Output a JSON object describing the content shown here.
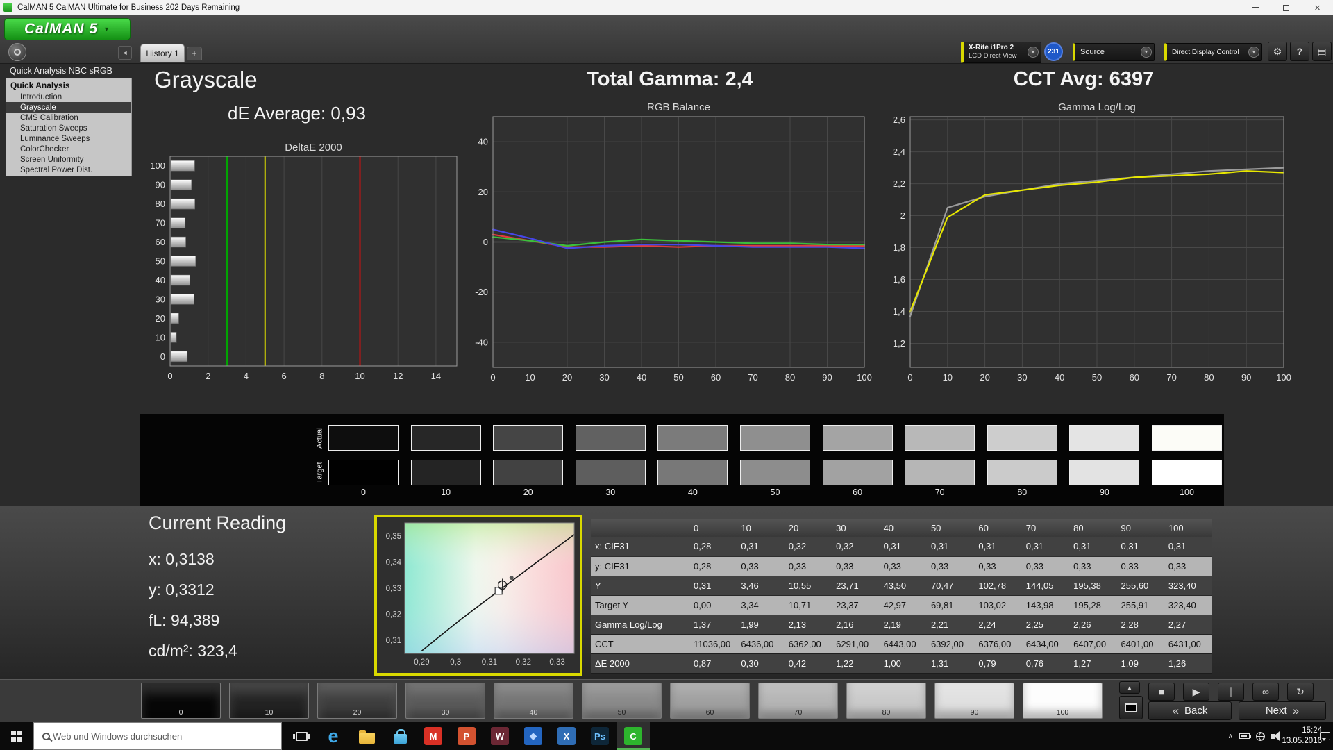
{
  "colors": {
    "accent_green": "#2fc12f",
    "selection_yellow": "#d9d900",
    "ref_green": "#00a800",
    "ref_yellow": "#d8d800",
    "ref_red": "#cc1111",
    "badge_blue": "#1f58c8"
  },
  "window": {
    "title": "CalMAN 5 CalMAN Ultimate for Business 202 Days Remaining",
    "logo_text": "CalMAN 5"
  },
  "header": {
    "tab_label": "History 1",
    "new_tab_glyph": "+",
    "meter_line1": "X-Rite i1Pro 2",
    "meter_line2": "LCD Direct View",
    "meter_badge": "231",
    "source_label": "Source",
    "display_control_label": "Direct Display Control",
    "help_glyph": "?"
  },
  "sidebar": {
    "title": "Quick Analysis NBC sRGB",
    "root_label": "Quick Analysis",
    "items": [
      "Introduction",
      "Grayscale",
      "CMS Calibration",
      "Saturation Sweeps",
      "Luminance Sweeps",
      "ColorChecker",
      "Screen Uniformity",
      "Spectral Power Dist."
    ],
    "selected_index": 1
  },
  "headline": {
    "page_title": "Grayscale",
    "de_average": "dE Average: 0,93",
    "total_gamma": "Total Gamma: 2,4",
    "cct_avg": "CCT Avg: 6397"
  },
  "chart_data": [
    {
      "id": "deltae",
      "type": "bar",
      "orientation": "horizontal",
      "title": "DeltaE 2000",
      "categories": [
        "100",
        "90",
        "80",
        "70",
        "60",
        "50",
        "40",
        "30",
        "20",
        "10",
        "0"
      ],
      "values": [
        1.26,
        1.09,
        1.27,
        0.76,
        0.79,
        1.31,
        1.0,
        1.22,
        0.42,
        0.3,
        0.87
      ],
      "xlim": [
        0,
        15.1
      ],
      "xticks": [
        [
          0,
          "0"
        ],
        [
          2,
          "2"
        ],
        [
          4,
          "4"
        ],
        [
          6,
          "6"
        ],
        [
          8,
          "8"
        ],
        [
          10,
          "10"
        ],
        [
          12,
          "12"
        ],
        [
          14,
          "14"
        ]
      ],
      "reference_lines": [
        [
          3,
          "#00a800"
        ],
        [
          5,
          "#d8d800"
        ],
        [
          10,
          "#cc1111"
        ]
      ]
    },
    {
      "id": "rgb_balance",
      "type": "line",
      "title": "RGB Balance",
      "x": [
        0,
        10,
        20,
        30,
        40,
        50,
        60,
        70,
        80,
        90,
        100
      ],
      "xlim": [
        0,
        100
      ],
      "xticks": [
        [
          0,
          "0"
        ],
        [
          10,
          "10"
        ],
        [
          20,
          "20"
        ],
        [
          30,
          "30"
        ],
        [
          40,
          "40"
        ],
        [
          50,
          "50"
        ],
        [
          60,
          "60"
        ],
        [
          70,
          "70"
        ],
        [
          80,
          "80"
        ],
        [
          90,
          "90"
        ],
        [
          100,
          "100"
        ]
      ],
      "ylim": [
        -50,
        50
      ],
      "yticks": [
        [
          40,
          "40"
        ],
        [
          20,
          "20"
        ],
        [
          0,
          "0"
        ],
        [
          -20,
          "-20"
        ],
        [
          -40,
          "-40"
        ]
      ],
      "grid": true,
      "legend": "none",
      "series": [
        {
          "name": "red",
          "color": "#e23b3b",
          "values": [
            3,
            0.5,
            -2,
            -2,
            -1.5,
            -2,
            -1.5,
            -1.5,
            -1.5,
            -1.5,
            -1.5
          ]
        },
        {
          "name": "green",
          "color": "#3bbf3b",
          "values": [
            2,
            0.5,
            -1.5,
            0,
            1,
            0.5,
            0,
            -0.5,
            -0.5,
            -1,
            -1
          ]
        },
        {
          "name": "blue",
          "color": "#4646e8",
          "values": [
            5,
            1.5,
            -2.5,
            -1.5,
            -1,
            -1,
            -1.5,
            -2,
            -2,
            -2,
            -2.5
          ]
        }
      ]
    },
    {
      "id": "gamma",
      "type": "line",
      "title": "Gamma Log/Log",
      "x": [
        0,
        10,
        20,
        30,
        40,
        50,
        60,
        70,
        80,
        90,
        100
      ],
      "xlim": [
        0,
        100
      ],
      "xticks": [
        [
          0,
          "0"
        ],
        [
          10,
          "10"
        ],
        [
          20,
          "20"
        ],
        [
          30,
          "30"
        ],
        [
          40,
          "40"
        ],
        [
          50,
          "50"
        ],
        [
          60,
          "60"
        ],
        [
          70,
          "70"
        ],
        [
          80,
          "80"
        ],
        [
          90,
          "90"
        ],
        [
          100,
          "100"
        ]
      ],
      "ylim": [
        1.05,
        2.62
      ],
      "yticks": [
        [
          2.6,
          "2,6"
        ],
        [
          2.4,
          "2,4"
        ],
        [
          2.2,
          "2,2"
        ],
        [
          2,
          "2"
        ],
        [
          1.8,
          "1,8"
        ],
        [
          1.6,
          "1,6"
        ],
        [
          1.4,
          "1,4"
        ],
        [
          1.2,
          "1,2"
        ]
      ],
      "grid": true,
      "legend": "none",
      "series": [
        {
          "name": "target",
          "color": "#9c9c9c",
          "values": [
            1.37,
            2.05,
            2.12,
            2.16,
            2.2,
            2.22,
            2.24,
            2.26,
            2.28,
            2.29,
            2.3
          ]
        },
        {
          "name": "measured",
          "color": "#e8e800",
          "values": [
            1.4,
            1.99,
            2.13,
            2.16,
            2.19,
            2.21,
            2.24,
            2.25,
            2.26,
            2.28,
            2.27
          ]
        }
      ]
    },
    {
      "id": "cie",
      "type": "scatter",
      "title": "",
      "xlim": [
        0.285,
        0.335
      ],
      "ylim": [
        0.305,
        0.355
      ],
      "xticks": [
        [
          0.29,
          "0,29"
        ],
        [
          0.3,
          "0,3"
        ],
        [
          0.31,
          "0,31"
        ],
        [
          0.32,
          "0,32"
        ],
        [
          0.33,
          "0,33"
        ]
      ],
      "yticks": [
        [
          0.35,
          "0,35"
        ],
        [
          0.34,
          "0,34"
        ],
        [
          0.33,
          "0,33"
        ],
        [
          0.32,
          "0,32"
        ],
        [
          0.31,
          "0,31"
        ]
      ],
      "locus": [
        [
          0.29,
          0.306
        ],
        [
          0.301,
          0.3175
        ],
        [
          0.3127,
          0.329
        ],
        [
          0.323,
          0.339
        ],
        [
          0.335,
          0.3505
        ]
      ],
      "target_point": [
        0.3127,
        0.329
      ],
      "actual_point": [
        0.3138,
        0.3312
      ],
      "extra_point": [
        0.3165,
        0.334
      ]
    }
  ],
  "swatches": {
    "top_label": "Actual",
    "bottom_label": "Target",
    "levels": [
      "0",
      "10",
      "20",
      "30",
      "40",
      "50",
      "60",
      "70",
      "80",
      "90",
      "100"
    ],
    "actual_colors": [
      "#0e0e0e",
      "#272727",
      "#454545",
      "#616161",
      "#7b7b7b",
      "#8f8f8f",
      "#a4a4a4",
      "#b8b8b8",
      "#cdcdcd",
      "#e4e4e4",
      "#fcfcf7"
    ],
    "target_colors": [
      "#010101",
      "#242424",
      "#424242",
      "#5e5e5e",
      "#787878",
      "#8d8d8d",
      "#a2a2a2",
      "#b6b6b6",
      "#cbcbcb",
      "#e3e3e3",
      "#ffffff"
    ]
  },
  "current_reading": {
    "title": "Current Reading",
    "x_value": "x: 0,3138",
    "y_value": "y: 0,3312",
    "fl_value": "fL: 94,389",
    "cd_value": "cd/m²: 323,4"
  },
  "results_table": {
    "header": [
      "",
      "0",
      "10",
      "20",
      "30",
      "40",
      "50",
      "60",
      "70",
      "80",
      "90",
      "100"
    ],
    "rows": [
      {
        "label": "x: CIE31",
        "values": [
          "0,28",
          "0,31",
          "0,32",
          "0,32",
          "0,31",
          "0,31",
          "0,31",
          "0,31",
          "0,31",
          "0,31",
          "0,31"
        ]
      },
      {
        "label": "y: CIE31",
        "values": [
          "0,28",
          "0,33",
          "0,33",
          "0,33",
          "0,33",
          "0,33",
          "0,33",
          "0,33",
          "0,33",
          "0,33",
          "0,33"
        ]
      },
      {
        "label": "Y",
        "values": [
          "0,31",
          "3,46",
          "10,55",
          "23,71",
          "43,50",
          "70,47",
          "102,78",
          "144,05",
          "195,38",
          "255,60",
          "323,40"
        ]
      },
      {
        "label": "Target Y",
        "values": [
          "0,00",
          "3,34",
          "10,71",
          "23,37",
          "42,97",
          "69,81",
          "103,02",
          "143,98",
          "195,28",
          "255,91",
          "323,40"
        ]
      },
      {
        "label": "Gamma Log/Log",
        "values": [
          "1,37",
          "1,99",
          "2,13",
          "2,16",
          "2,19",
          "2,21",
          "2,24",
          "2,25",
          "2,26",
          "2,28",
          "2,27"
        ]
      },
      {
        "label": "CCT",
        "values": [
          "11036,00",
          "6436,00",
          "6362,00",
          "6291,00",
          "6443,00",
          "6392,00",
          "6376,00",
          "6434,00",
          "6407,00",
          "6401,00",
          "6431,00"
        ]
      },
      {
        "label": "ΔE 2000",
        "values": [
          "0,87",
          "0,30",
          "0,42",
          "1,22",
          "1,00",
          "1,31",
          "0,79",
          "0,76",
          "1,27",
          "1,09",
          "1,26"
        ]
      }
    ]
  },
  "level_bar": {
    "levels": [
      "0",
      "10",
      "20",
      "30",
      "40",
      "50",
      "60",
      "70",
      "80",
      "90",
      "100"
    ],
    "colors": [
      "#070707",
      "#232323",
      "#3e3e3e",
      "#5a5a5a",
      "#757575",
      "#8a8a8a",
      "#a0a0a0",
      "#b5b5b5",
      "#cacaca",
      "#e0e0e0",
      "#fdfdfd"
    ],
    "transport": [
      {
        "name": "stop",
        "glyph": "■"
      },
      {
        "name": "play",
        "glyph": "▶"
      },
      {
        "name": "pause",
        "glyph": "∥"
      },
      {
        "name": "continuous",
        "glyph": "∞"
      },
      {
        "name": "refresh",
        "glyph": "↻"
      }
    ],
    "back_chevron": "«",
    "back_label": "Back",
    "next_label": "Next",
    "next_chevron": "»"
  },
  "taskbar": {
    "search_placeholder": "Web und Windows durchsuchen",
    "apps": [
      {
        "name": "edge",
        "kind": "glyph",
        "glyph": "e",
        "fg": "#3fa9e8"
      },
      {
        "name": "file-explorer",
        "kind": "folder"
      },
      {
        "name": "store",
        "kind": "bag"
      },
      {
        "name": "mail",
        "kind": "tile",
        "glyph": "M",
        "bg": "#d93025",
        "fg": "#ffffff"
      },
      {
        "name": "powerpoint",
        "kind": "tile",
        "glyph": "P",
        "bg": "#d35230",
        "fg": "#ffffff"
      },
      {
        "name": "word",
        "kind": "tile",
        "glyph": "W",
        "bg": "#6b2734",
        "fg": "#ffffff"
      },
      {
        "name": "photos",
        "kind": "tile",
        "glyph": "◆",
        "bg": "#2365c0",
        "fg": "#bcd8ff"
      },
      {
        "name": "excel",
        "kind": "tile",
        "glyph": "X",
        "bg": "#2f6db5",
        "fg": "#ffffff"
      },
      {
        "name": "photoshop",
        "kind": "tile",
        "glyph": "Ps",
        "bg": "#0e2638",
        "fg": "#6fc1ff"
      },
      {
        "name": "calman",
        "kind": "tile",
        "glyph": "C",
        "bg": "#2db52d",
        "fg": "#ffffff",
        "active": true
      }
    ],
    "time": "15:24",
    "date": "13.05.2016"
  }
}
